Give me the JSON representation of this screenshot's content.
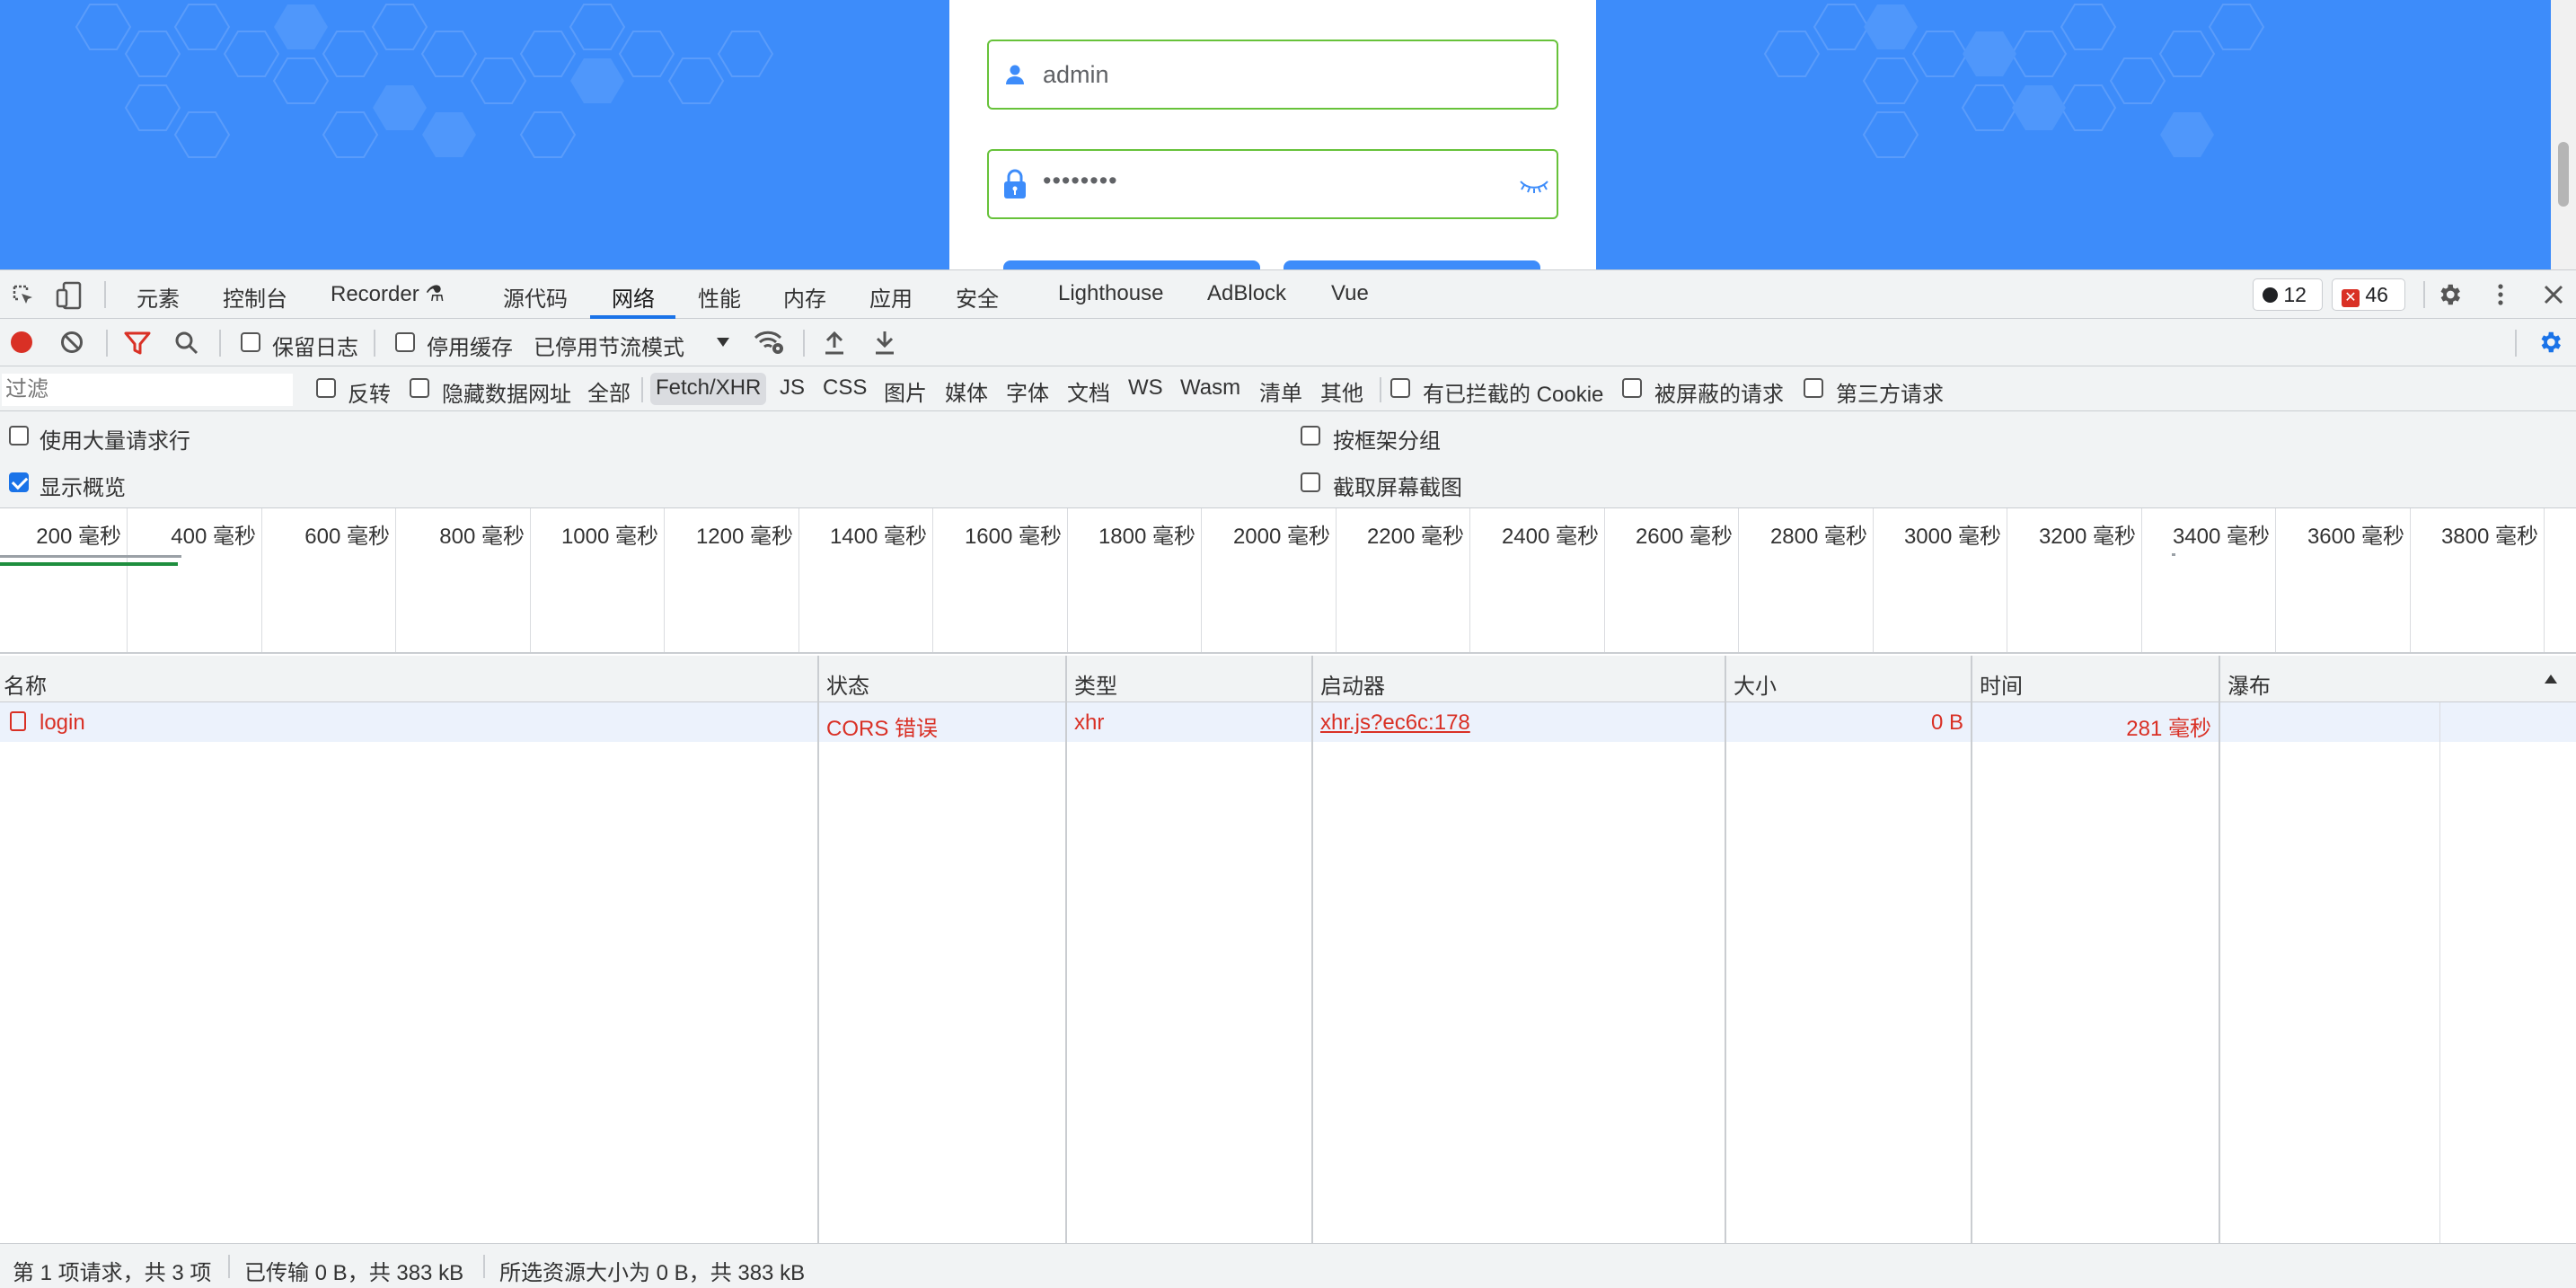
{
  "login_form": {
    "username_value": "admin",
    "password_value": "••••••••"
  },
  "colors": {
    "page_bg": "#3d8cfa",
    "input_border": "#67c23a",
    "accent": "#1a73e8",
    "error": "#d93025"
  },
  "devtools_tabs": [
    "元素",
    "控制台",
    "Recorder",
    "源代码",
    "网络",
    "性能",
    "内存",
    "应用",
    "安全",
    "Lighthouse",
    "AdBlock",
    "Vue"
  ],
  "active_tab": "网络",
  "badges": {
    "warnings": "12",
    "errors": "46"
  },
  "toolbar": {
    "preserve_log": "保留日志",
    "disable_cache": "停用缓存",
    "throttling": "已停用节流模式"
  },
  "filter": {
    "placeholder": "过滤",
    "invert": "反转",
    "hide_data_urls": "隐藏数据网址",
    "types": [
      "全部",
      "Fetch/XHR",
      "JS",
      "CSS",
      "图片",
      "媒体",
      "字体",
      "文档",
      "WS",
      "Wasm",
      "清单",
      "其他"
    ],
    "selected_type": "Fetch/XHR",
    "blocked_cookies": "有已拦截的 Cookie",
    "blocked_requests": "被屏蔽的请求",
    "third_party": "第三方请求"
  },
  "options": {
    "large_rows": "使用大量请求行",
    "group_by_frame": "按框架分组",
    "show_overview": "显示概览",
    "capture_screenshots": "截取屏幕截图"
  },
  "timeline_ticks": [
    "200 毫秒",
    "400 毫秒",
    "600 毫秒",
    "800 毫秒",
    "1000 毫秒",
    "1200 毫秒",
    "1400 毫秒",
    "1600 毫秒",
    "1800 毫秒",
    "2000 毫秒",
    "2200 毫秒",
    "2400 毫秒",
    "2600 毫秒",
    "2800 毫秒",
    "3000 毫秒",
    "3200 毫秒",
    "3400 毫秒",
    "3600 毫秒",
    "3800 毫秒"
  ],
  "table": {
    "headers": {
      "name": "名称",
      "status": "状态",
      "type": "类型",
      "initiator": "启动器",
      "size": "大小",
      "time": "时间",
      "waterfall": "瀑布"
    },
    "rows": [
      {
        "name": "login",
        "status": "CORS 错误",
        "type": "xhr",
        "initiator": "xhr.js?ec6c:178",
        "size": "0 B",
        "time": "281 毫秒"
      }
    ]
  },
  "statusbar": {
    "requests": "第 1 项请求，共 3 项",
    "transferred": "已传输 0 B，共 383 kB",
    "resources": "所选资源大小为 0 B，共 383 kB"
  }
}
